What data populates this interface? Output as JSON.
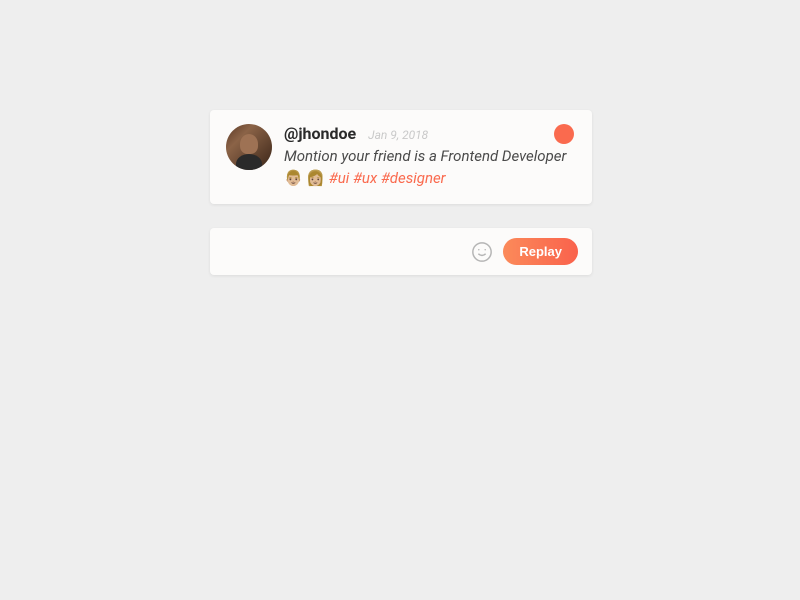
{
  "post": {
    "username": "@jhondoe",
    "date": "Jan 9, 2018",
    "text": "Montion your friend is a Frontend Developer",
    "emojis": "👨🏼 👩🏼",
    "hashtags": "#ui #ux #designer"
  },
  "actions": {
    "replay_label": "Replay"
  }
}
